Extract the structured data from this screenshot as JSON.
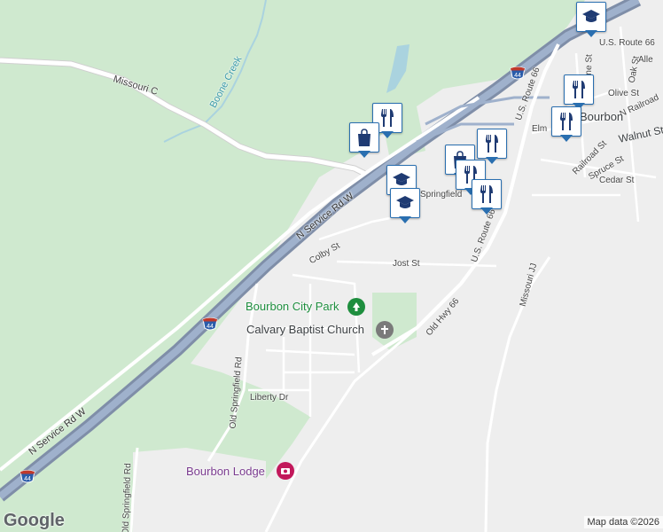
{
  "map": {
    "labels": {
      "missouri_c": "Missouri C",
      "boone_creek": "Boone Creek",
      "n_service_rd_top": "N Service Rd W",
      "n_service_rd_bottom": "N Service Rd W",
      "colby_st": "Colby St",
      "jost_st": "Jost St",
      "us_route_66_main": "U.S. Route 66",
      "us_route_66_top": "U.S. Route 66",
      "us_route_66_north": "U.S. Route 66",
      "old_hwy_66": "Old Hwy 66",
      "missouri_jj": "Missouri JJ",
      "old_springfield_rd": "Old Springfield Rd",
      "old_springfield_rd_bottom": "Old Springfield Rd",
      "liberty_dr": "Liberty Dr",
      "springfield_partial": "Springfield",
      "pine_st": "Pine St",
      "oak_st": "Oak St",
      "alle": "Alle",
      "olive_st": "Olive St",
      "n_railroad": "N Railroad",
      "elm": "Elm",
      "walnut_st": "Walnut St",
      "railroad_st": "Railroad St",
      "spruce_st": "Spruce St",
      "cedar_st": "Cedar St",
      "bourbon_town": "Bourbon"
    },
    "places": {
      "bourbon_city_park": "Bourbon City Park",
      "calvary_baptist_church": "Calvary Baptist Church",
      "bourbon_lodge": "Bourbon Lodge"
    },
    "shields": {
      "i44_top": "44",
      "i44_mid": "44",
      "i44_bottom": "44"
    },
    "pins": [
      {
        "name": "restaurant-pin",
        "icon": "fork-knife-icon"
      },
      {
        "name": "shopping-pin",
        "icon": "shopping-bag-icon"
      },
      {
        "name": "school-pin",
        "icon": "graduation-cap-icon"
      },
      {
        "name": "school-pin-2",
        "icon": "graduation-cap-icon"
      },
      {
        "name": "shopping-pin-2",
        "icon": "shopping-bag-icon"
      },
      {
        "name": "restaurant-pin-2",
        "icon": "fork-knife-icon"
      },
      {
        "name": "restaurant-pin-3",
        "icon": "fork-knife-icon"
      },
      {
        "name": "restaurant-pin-4",
        "icon": "fork-knife-icon"
      },
      {
        "name": "school-pin-3",
        "icon": "graduation-cap-icon"
      },
      {
        "name": "restaurant-pin-5",
        "icon": "fork-knife-icon"
      },
      {
        "name": "restaurant-pin-6",
        "icon": "fork-knife-icon"
      }
    ],
    "colors": {
      "park_green": "#cfe9cf",
      "urban_gray": "#eeeeee",
      "highway": "#8ea2c0",
      "water": "#aad3df",
      "pin_border": "#2a6fb0"
    }
  },
  "branding": {
    "google_logo": "Google",
    "attribution": "Map data ©2026"
  }
}
